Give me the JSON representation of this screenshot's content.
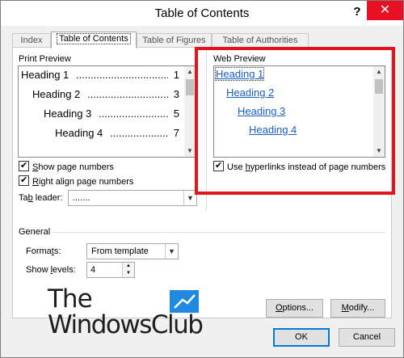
{
  "window": {
    "title": "Table of Contents",
    "help_label": "?",
    "close_label": "✕"
  },
  "tabs": [
    {
      "label": "Index",
      "active": false
    },
    {
      "label": "Table of Contents",
      "active": true
    },
    {
      "label": "Table of Figures",
      "active": false
    },
    {
      "label": "Table of Authorities",
      "active": false
    }
  ],
  "print_preview": {
    "label": "Print Preview",
    "entries": [
      {
        "text": "Heading 1",
        "page": "1"
      },
      {
        "text": "Heading 2",
        "page": "3"
      },
      {
        "text": "Heading 3",
        "page": "5"
      },
      {
        "text": "Heading 4",
        "page": "7"
      }
    ],
    "dots": "........................................................",
    "show_page_numbers": {
      "label_pre": "",
      "label_ul": "S",
      "label_post": "how page numbers",
      "checked": true
    },
    "right_align_page_numbers": {
      "label_pre": "",
      "label_ul": "R",
      "label_post": "ight align page numbers",
      "checked": true
    },
    "tab_leader": {
      "label_pre": "Ta",
      "label_ul": "b",
      "label_post": " leader:",
      "value": "......."
    }
  },
  "web_preview": {
    "label": "Web Preview",
    "links": [
      "Heading 1",
      "Heading 2",
      "Heading 3",
      "Heading 4"
    ],
    "use_hyperlinks": {
      "label_pre": "Use ",
      "label_ul": "h",
      "label_post": "yperlinks instead of page numbers",
      "checked": true
    }
  },
  "general": {
    "label": "General",
    "formats": {
      "label_pre": "Forma",
      "label_ul": "t",
      "label_post": "s:",
      "value": "From template"
    },
    "show_levels": {
      "label_pre": "Show ",
      "label_ul": "l",
      "label_post": "evels:",
      "value": "4"
    }
  },
  "buttons": {
    "options": "Options...",
    "modify": "Modify...",
    "ok": "OK",
    "cancel": "Cancel"
  },
  "watermark": {
    "line1": "The",
    "line2": "WindowsClub",
    "accent_color": "#1f8ae0"
  },
  "colors": {
    "highlight_border": "#e2141c",
    "close_button": "#e81123",
    "link": "#1a5ec7"
  }
}
